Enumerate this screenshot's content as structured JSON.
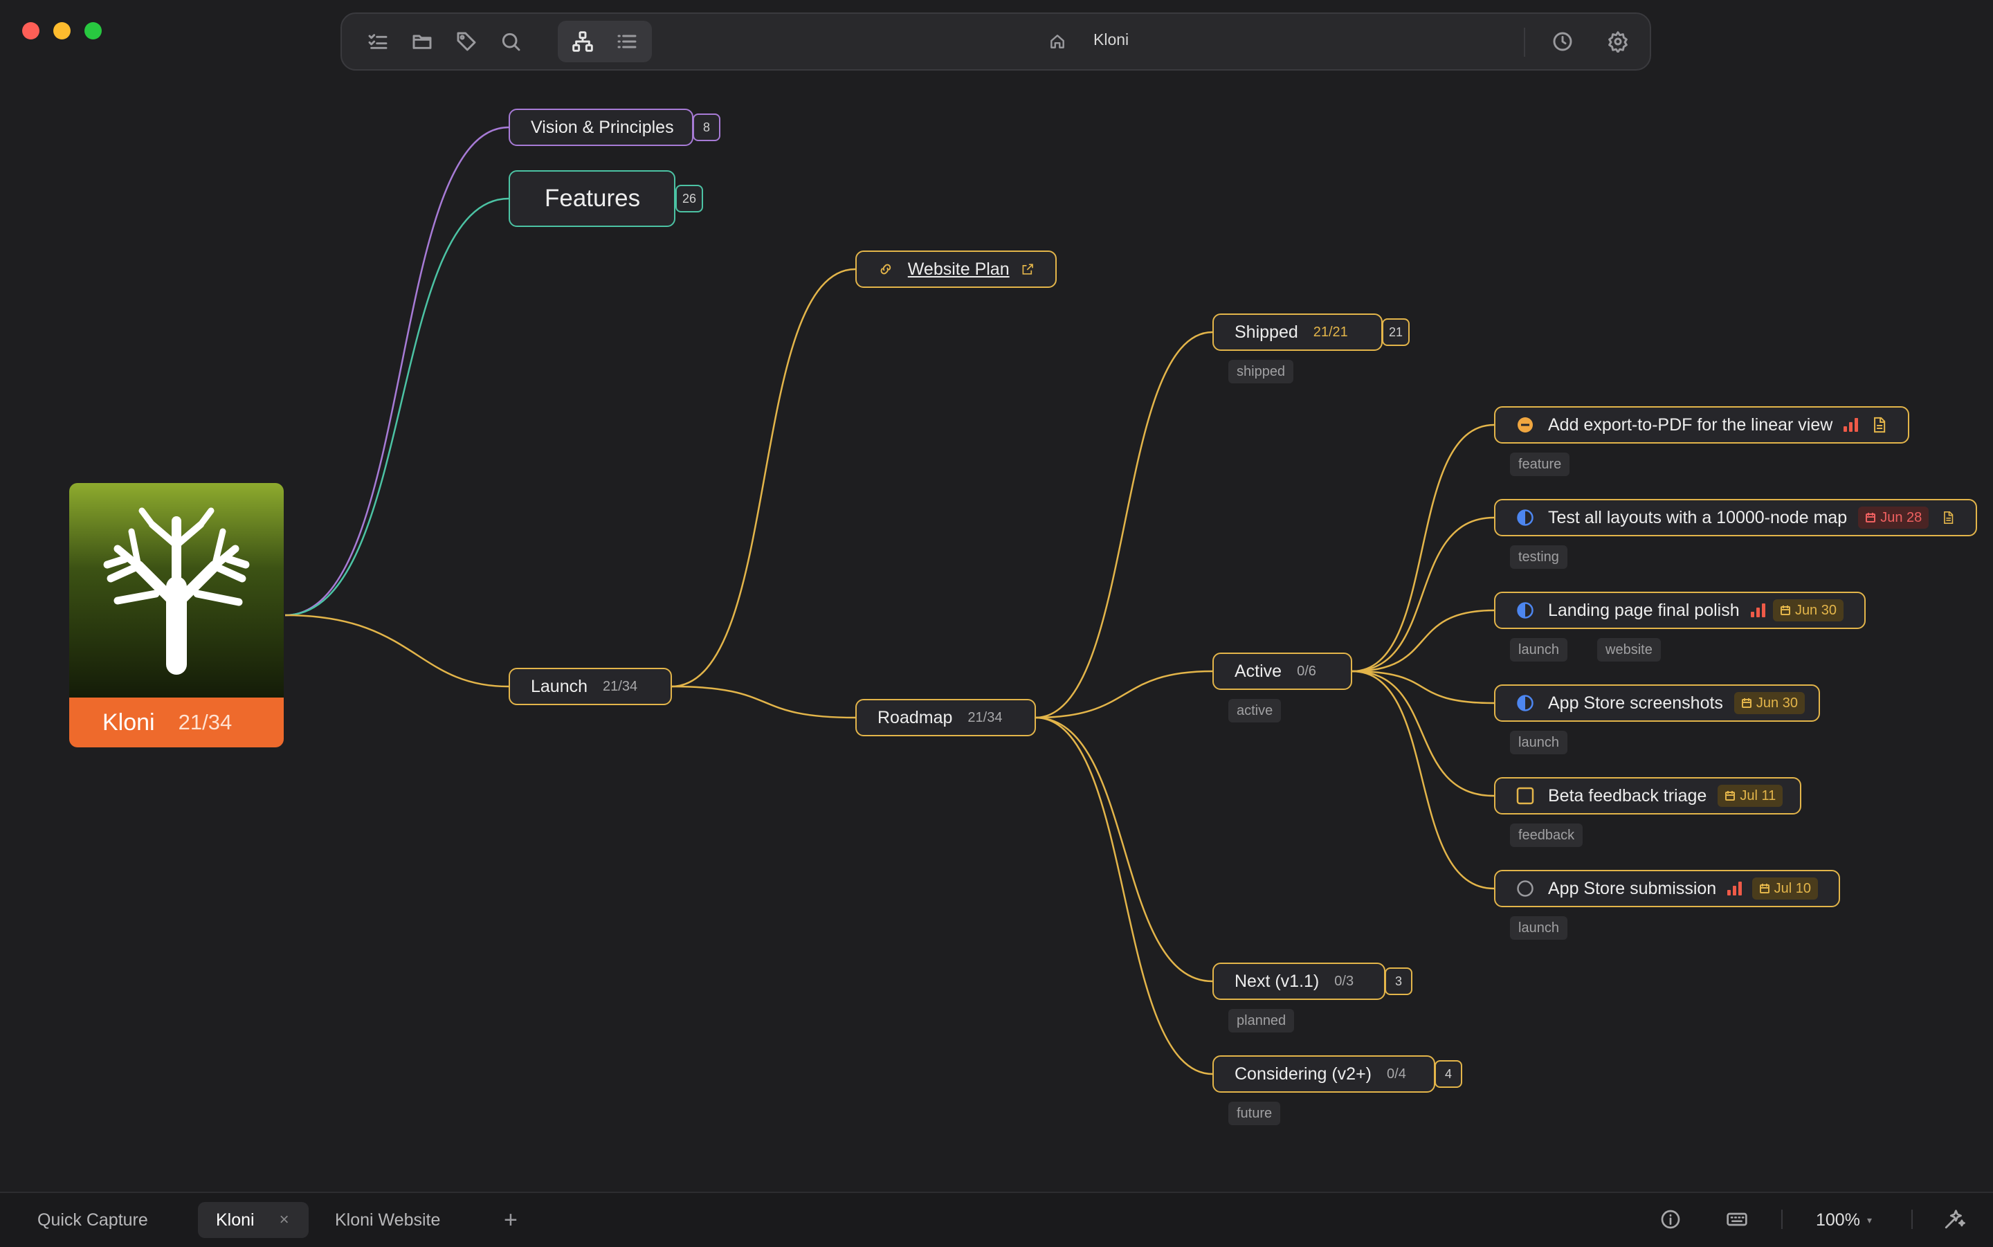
{
  "window": {
    "title": "Kloni"
  },
  "toolbar": {
    "title": "Kloni",
    "icons": [
      "checklist-icon",
      "folder-icon",
      "tag-icon",
      "search-icon",
      "mindmap-icon",
      "outline-icon",
      "home-icon",
      "history-icon",
      "settings-icon"
    ]
  },
  "root": {
    "label": "Kloni",
    "count": "21/34",
    "icon": "tree-icon"
  },
  "nodes": {
    "vision": {
      "label": "Vision & Principles",
      "badge": "8"
    },
    "features": {
      "label": "Features",
      "badge": "26"
    },
    "launch": {
      "label": "Launch",
      "count": "21/34"
    },
    "website_plan": {
      "label": "Website Plan"
    },
    "roadmap": {
      "label": "Roadmap",
      "count": "21/34"
    },
    "shipped": {
      "label": "Shipped",
      "count": "21/21",
      "badge": "21",
      "tag": "shipped"
    },
    "active": {
      "label": "Active",
      "count": "0/6",
      "tag": "active"
    },
    "next": {
      "label": "Next (v1.1)",
      "count": "0/3",
      "badge": "3",
      "tag": "planned"
    },
    "considering": {
      "label": "Considering (v2+)",
      "count": "0/4",
      "badge": "4",
      "tag": "future"
    }
  },
  "tasks": [
    {
      "label": "Add export-to-PDF for the linear view",
      "status": "blocked",
      "priority": "high",
      "has_note": true,
      "tags": [
        "feature"
      ]
    },
    {
      "label": "Test all layouts with a 10000-node map",
      "status": "in-progress",
      "date": "Jun 28",
      "date_overdue": true,
      "has_note": true,
      "tags": [
        "testing"
      ]
    },
    {
      "label": "Landing page final polish",
      "status": "in-progress",
      "priority": "high",
      "date": "Jun 30",
      "tags": [
        "launch",
        "website"
      ]
    },
    {
      "label": "App Store screenshots",
      "status": "in-progress",
      "date": "Jun 30",
      "tags": [
        "launch"
      ]
    },
    {
      "label": "Beta feedback triage",
      "status": "todo",
      "date": "Jul 11",
      "tags": [
        "feedback"
      ]
    },
    {
      "label": "App Store submission",
      "status": "not-started",
      "priority": "high",
      "date": "Jul 10",
      "tags": [
        "launch"
      ]
    }
  ],
  "statusbar": {
    "tabs": [
      "Quick Capture",
      "Kloni",
      "Kloni Website"
    ],
    "active_tab": "Kloni",
    "close": "×",
    "add": "+",
    "zoom": "100%",
    "zoom_caret": "▾"
  },
  "colors": {
    "accent": "#e3b54a",
    "vision": "#a77bd6",
    "features": "#4cc3a4",
    "background": "#1e1e20",
    "root_bar": "#ee6a2c",
    "overdue": "#ef6060",
    "in_progress": "#4d86f0",
    "blocked": "#f0a640"
  }
}
